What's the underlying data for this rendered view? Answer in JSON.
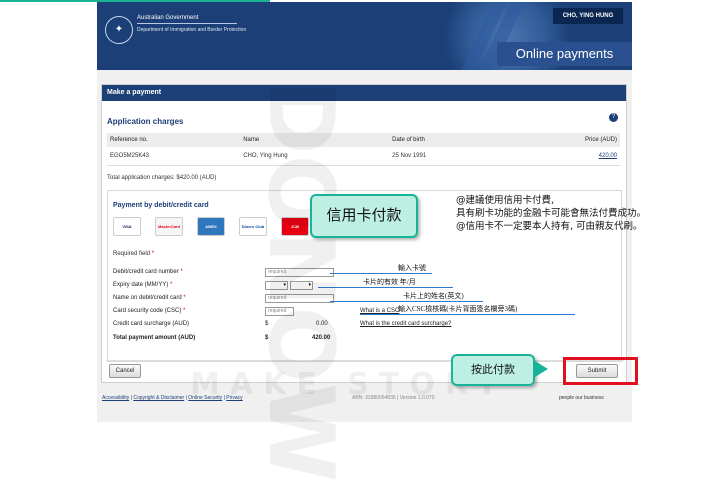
{
  "header": {
    "gov_line1": "Australian Government",
    "gov_line2": "Department of Immigration and Border Protection",
    "user_name": "CHO, YING HUNG",
    "banner_title": "Online payments"
  },
  "card": {
    "header": "Make a payment",
    "section_title": "Application charges",
    "columns": [
      "Reference no.",
      "Name",
      "Date of birth",
      "Price (AUD)"
    ],
    "row": {
      "ref": "EGO5M25K43",
      "name": "CHO, Ying Hung",
      "dob": "25 Nov 1991",
      "price": "420.00"
    },
    "total_line": "Total application charges: $420.00 (AUD)"
  },
  "payment": {
    "title": "Payment by debit/credit card",
    "cards": [
      "VISA",
      "MasterCard",
      "AMEX",
      "Diners Club",
      "JCB"
    ],
    "required_note": "Required field",
    "fields": {
      "card_number": {
        "label": "Debit/credit card number",
        "placeholder": "required"
      },
      "expiry": {
        "label": "Expiry date (MM/YY)"
      },
      "name": {
        "label": "Name on debit/credit card",
        "placeholder": "required"
      },
      "csc": {
        "label": "Card security code (CSC)",
        "placeholder": "required",
        "link": "What is a CSC"
      },
      "surcharge": {
        "label": "Credit card surcharge (AUD)",
        "currency": "$",
        "value": "0.00",
        "link": "What is the credit card surcharge?"
      },
      "total": {
        "label": "Total payment amount (AUD)",
        "currency": "$",
        "value": "420.00"
      }
    },
    "cancel_label": "Cancel",
    "submit_label": "Submit"
  },
  "footer": {
    "links": [
      "Accessibility",
      "Copyright & Disclaimer",
      "Online Security",
      "Privacy"
    ],
    "separator": "|",
    "abn": "ABN: 33380054835 | Version 1.0.070",
    "people": "people our business"
  },
  "annotations": {
    "credit_card_pay": "信用卡付款",
    "card_number_note": "輸入卡號",
    "expiry_note": "卡片的有效 年/月",
    "name_note": "卡片上的姓名(英文)",
    "csc_note": "輸入CSC檢核碼(卡片背面簽名欄旁3碼)",
    "click_to_pay": "按此付款",
    "note_line1": "@建議使用信用卡付費,",
    "note_line2": "具有刷卡功能的金融卡可能會無法付費成功。",
    "note_line3": "@信用卡不一定要本人持有, 可由親友代刷。"
  },
  "watermark": "DONOW",
  "watermark_sub": "MAKE STORY",
  "colors": {
    "navy": "#1b3f76",
    "teal": "#18b39a",
    "red": "#e01020"
  }
}
